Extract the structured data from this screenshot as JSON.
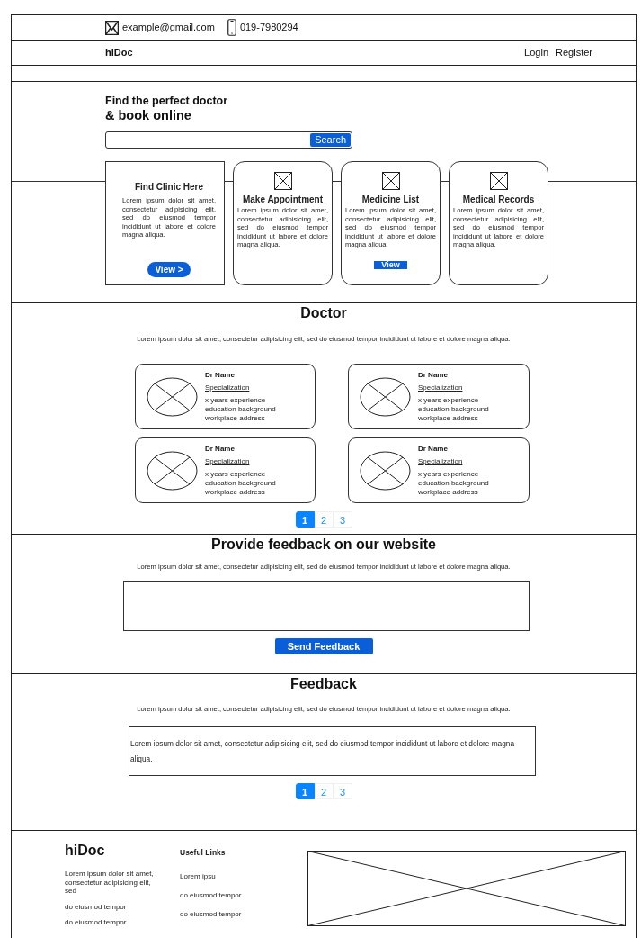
{
  "contact": {
    "email": "example@gmail.com",
    "phone": "019-7980294"
  },
  "nav": {
    "brand": "hiDoc",
    "links": [
      "Login",
      "Register"
    ]
  },
  "hero": {
    "title_line_1": "Find the perfect doctor",
    "title_line_2": "& book online",
    "search_button": "Search"
  },
  "services": [
    {
      "kind": "plain",
      "title": "Find Clinic Here",
      "text": "Lorem ipsum dolor sit amet, consectetur adipisicing elit, sed do eiusmod tempor incididunt ut labore et dolore magna aliqua.",
      "button": {
        "label": "View >",
        "kind": "pill"
      }
    },
    {
      "kind": "icon",
      "title": "Make Appointment",
      "text": "Lorem ipsum dolor sit amet, consectetur adipisicing elit, sed do eiusmod tempor incididunt ut labore et dolore magna aliqua."
    },
    {
      "kind": "icon",
      "title": "Medicine List",
      "text": "Lorem ipsum dolor sit amet, consectetur adipisicing elit, sed do eiusmod tempor incididunt ut labore et dolore magna aliqua.",
      "button": {
        "label": "View",
        "kind": "bar"
      }
    },
    {
      "kind": "icon",
      "title": "Medical Records",
      "text": "Lorem ipsum dolor sit amet, consectetur adipisicing elit, sed do eiusmod tempor incididunt ut labore et dolore magna aliqua."
    }
  ],
  "doctors": {
    "title": "Doctor",
    "intro": "Lorem ipsum dolor sit amet, consectetur adipisicing elit, sed do eiusmod tempor incididunt ut labore et dolore magna aliqua.",
    "items": [
      {
        "name": "Dr Name",
        "specialization": "Specialization",
        "details": [
          "x years experience",
          "education background",
          "workplace address"
        ]
      },
      {
        "name": "Dr Name",
        "specialization": "Specialization",
        "details": [
          "x years experience",
          "education background",
          "workplace address"
        ]
      },
      {
        "name": "Dr Name",
        "specialization": "Specialization",
        "details": [
          "x years experience",
          "education background",
          "workplace address"
        ]
      },
      {
        "name": "Dr Name",
        "specialization": "Specialization",
        "details": [
          "x years experience",
          "education background",
          "workplace address"
        ]
      }
    ],
    "pagination": [
      {
        "label": "1",
        "selected": true
      },
      {
        "label": "2",
        "selected": false
      },
      {
        "label": "3",
        "selected": false
      }
    ]
  },
  "feedback_form": {
    "title": "Provide feedback on our website",
    "intro": "Lorem ipsum dolor sit amet, consectetur adipisicing elit, sed do eiusmod tempor incididunt ut labore et dolore magna aliqua.",
    "button": "Send Feedback"
  },
  "feedback": {
    "title": "Feedback",
    "intro": "Lorem ipsum dolor sit amet, consectetur adipisicing elit, sed do eiusmod tempor incididunt ut labore et dolore magna aliqua.",
    "entries": [
      "Lorem ipsum dolor sit amet, consectetur adipisicing elit, sed do eiusmod tempor incididunt ut labore et dolore magna aliqua."
    ],
    "pagination": [
      {
        "label": "1",
        "selected": true
      },
      {
        "label": "2",
        "selected": false
      },
      {
        "label": "3",
        "selected": false
      }
    ]
  },
  "footer": {
    "brand": "hiDoc",
    "about": [
      "Lorem ipsum dolor sit amet, consectetur adipisicing elit, sed",
      "do eiusmod tempor",
      "do eiusmod tempor"
    ],
    "links_title": "Useful Links",
    "links": [
      "Lorem ipsu",
      "do eiusmod tempor",
      "do eiusmod tempor"
    ]
  }
}
